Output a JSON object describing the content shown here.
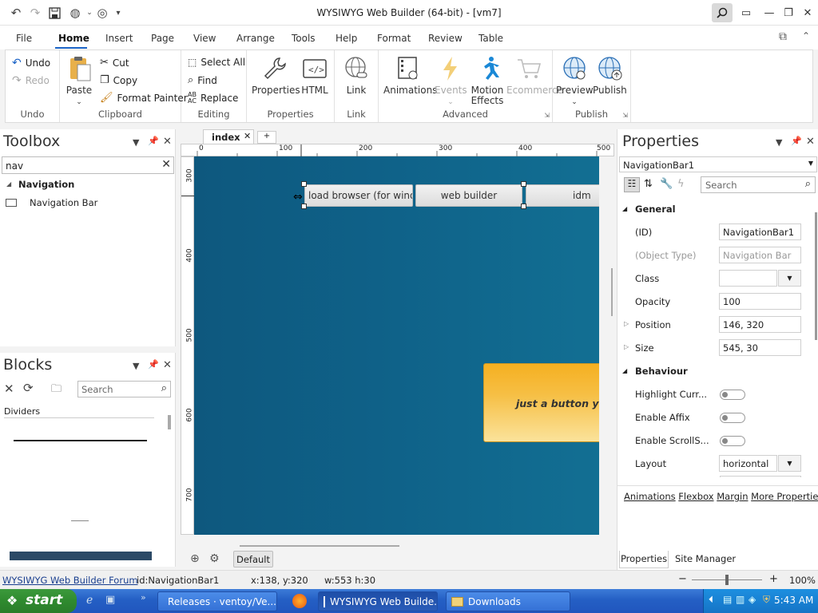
{
  "window": {
    "title": "WYSIWYG Web Builder (64-bit) - [vm7]"
  },
  "menu": [
    "File",
    "Home",
    "Insert",
    "Page",
    "View",
    "Arrange",
    "Tools",
    "Help",
    "Format",
    "Review",
    "Table"
  ],
  "ribbon": {
    "undo": {
      "undo": "Undo",
      "redo": "Redo",
      "group": "Undo"
    },
    "clipboard": {
      "paste": "Paste",
      "cut": "Cut",
      "copy": "Copy",
      "format_painter": "Format Painter",
      "group": "Clipboard"
    },
    "editing": {
      "select_all": "Select All",
      "find": "Find",
      "replace": "Replace",
      "group": "Editing"
    },
    "properties": {
      "properties": "Properties",
      "html": "HTML",
      "group": "Properties"
    },
    "link": {
      "link": "Link",
      "group": "Link"
    },
    "advanced": {
      "animations": "Animations",
      "events": "Events",
      "motion": "Motion",
      "effects": "Effects",
      "ecommerce": "Ecommerce",
      "group": "Advanced"
    },
    "publish": {
      "preview": "Preview",
      "publish": "Publish",
      "group": "Publish"
    }
  },
  "toolbox": {
    "title": "Toolbox",
    "search_value": "nav",
    "category": "Navigation",
    "items": [
      "Navigation Bar"
    ]
  },
  "blocks": {
    "title": "Blocks",
    "search_placeholder": "Search",
    "category": "Dividers"
  },
  "editor": {
    "tab": "index",
    "ruler_h": [
      "0",
      "100",
      "200",
      "300",
      "400",
      "500"
    ],
    "ruler_v": [
      "300",
      "400",
      "500",
      "600",
      "700"
    ],
    "nav_items": [
      "load browser (for wind",
      "web builder",
      "idm"
    ],
    "button_text": "just a button you",
    "page_selector": "Default"
  },
  "properties": {
    "title": "Properties",
    "object": "NavigationBar1",
    "search_placeholder": "Search",
    "cat_general": "General",
    "cat_behaviour": "Behaviour",
    "rows_general": [
      {
        "label": "(ID)",
        "value": "NavigationBar1",
        "dim": false
      },
      {
        "label": "(Object Type)",
        "value": "Navigation Bar",
        "dim": true
      },
      {
        "label": "Class",
        "value": "",
        "dim": false
      },
      {
        "label": "Opacity",
        "value": "100",
        "dim": false
      },
      {
        "label": "Position",
        "value": "146, 320",
        "dim": false
      },
      {
        "label": "Size",
        "value": "545, 30",
        "dim": false
      }
    ],
    "rows_behaviour": [
      {
        "label": "Highlight Curr...",
        "type": "toggle"
      },
      {
        "label": "Enable Affix",
        "type": "toggle"
      },
      {
        "label": "Enable ScrollS...",
        "type": "toggle"
      },
      {
        "label": "Layout",
        "value": "horizontal",
        "type": "select"
      }
    ],
    "links": [
      "Animations",
      "Flexbox",
      "Margin",
      "More Properties"
    ],
    "tabs": [
      "Properties",
      "Site Manager"
    ]
  },
  "status": {
    "forum": "WYSIWYG Web Builder Forum",
    "id": "id:NavigationBar1",
    "pos": "x:138, y:320",
    "size": "w:553 h:30",
    "zoom": "100%"
  },
  "taskbar": {
    "start": "start",
    "tasks": [
      "Releases · ventoy/Ve...",
      "WYSIWYG Web Builde...",
      "Downloads"
    ],
    "clock": "5:43 AM"
  },
  "colors": {
    "canvas": "#0f5e85",
    "accent": "#1a63c6",
    "nav_button": "#e9e9e9"
  }
}
